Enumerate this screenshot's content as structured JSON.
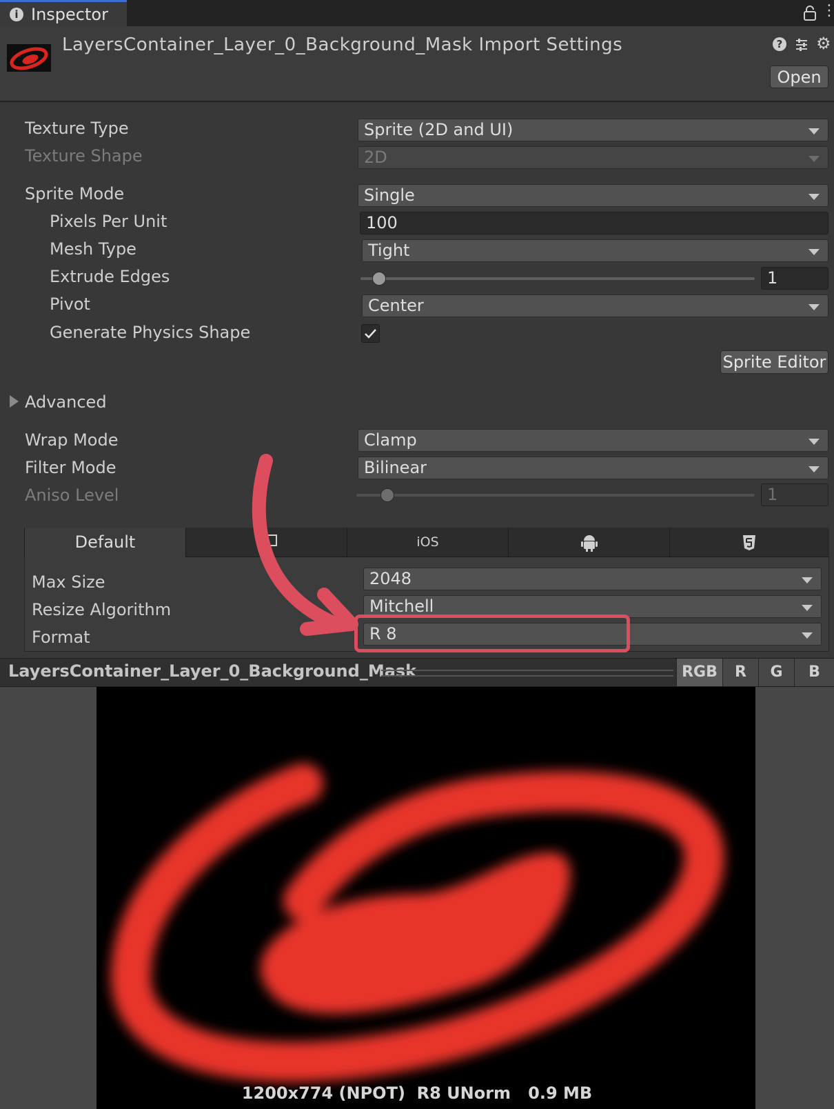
{
  "tab": {
    "title": "Inspector"
  },
  "header": {
    "title": "LayersContainer_Layer_0_Background_Mask Import Settings",
    "open_label": "Open"
  },
  "settings": {
    "texture_type": {
      "label": "Texture Type",
      "value": "Sprite (2D and UI)"
    },
    "texture_shape": {
      "label": "Texture Shape",
      "value": "2D"
    },
    "sprite_mode": {
      "label": "Sprite Mode",
      "value": "Single"
    },
    "pixels_per_unit": {
      "label": "Pixels Per Unit",
      "value": "100"
    },
    "mesh_type": {
      "label": "Mesh Type",
      "value": "Tight"
    },
    "extrude_edges": {
      "label": "Extrude Edges",
      "value": "1"
    },
    "pivot": {
      "label": "Pivot",
      "value": "Center"
    },
    "generate_physics_shape": {
      "label": "Generate Physics Shape",
      "checked": true
    },
    "sprite_editor_label": "Sprite Editor",
    "advanced_label": "Advanced",
    "wrap_mode": {
      "label": "Wrap Mode",
      "value": "Clamp"
    },
    "filter_mode": {
      "label": "Filter Mode",
      "value": "Bilinear"
    },
    "aniso_level": {
      "label": "Aniso Level",
      "value": "1"
    }
  },
  "platform": {
    "tabs": [
      {
        "label": "Default",
        "icon": null
      },
      {
        "label": "",
        "icon": "monitor-icon"
      },
      {
        "label": "iOS",
        "icon": null
      },
      {
        "label": "",
        "icon": "android-icon"
      },
      {
        "label": "",
        "icon": "html5-icon"
      }
    ],
    "max_size": {
      "label": "Max Size",
      "value": "2048"
    },
    "resize_algorithm": {
      "label": "Resize Algorithm",
      "value": "Mitchell"
    },
    "format": {
      "label": "Format",
      "value": "R 8"
    }
  },
  "preview": {
    "name": "LayersContainer_Layer_0_Background_Mask",
    "channels": [
      "RGB",
      "R",
      "G",
      "B"
    ],
    "info": "1200x774 (NPOT)  R8 UNorm   0.9 MB"
  },
  "colors": {
    "accent": "#3b6fd4",
    "annotation": "#dc4d5e",
    "mask_red": "#e8342a"
  }
}
